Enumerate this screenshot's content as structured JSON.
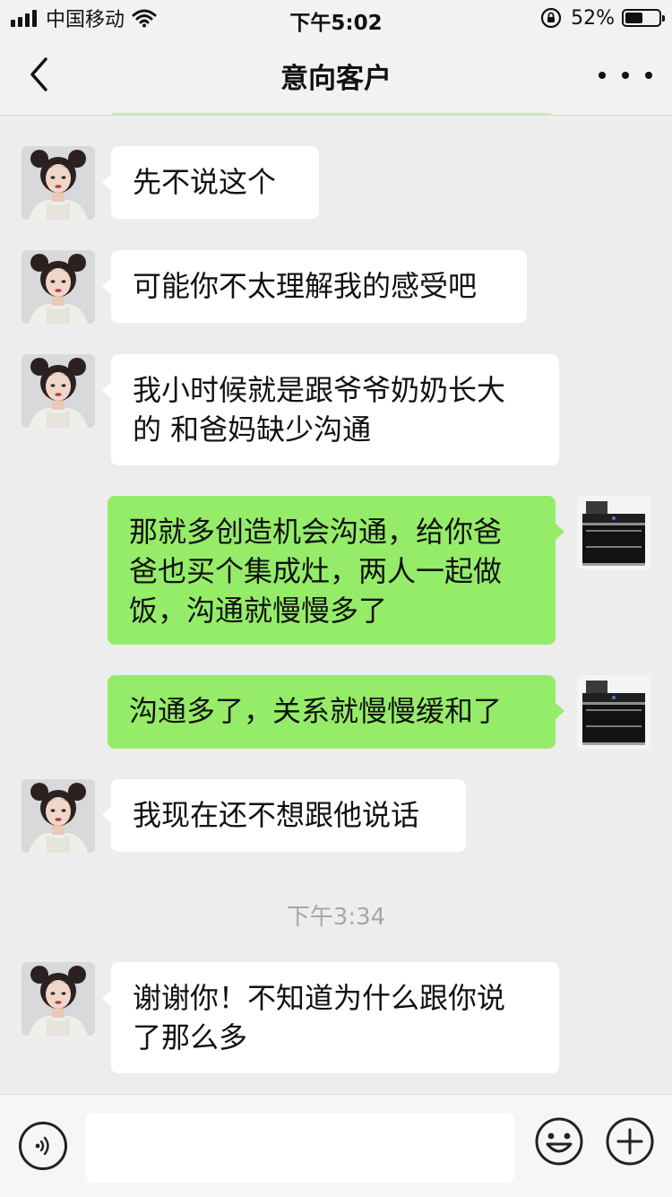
{
  "status_bar": {
    "carrier": "中国移动",
    "time": "下午5:02",
    "battery_percent": "52%",
    "battery_level": 0.52,
    "icons": [
      "signal-icon",
      "wifi-icon",
      "rotation-lock-icon",
      "battery-icon"
    ]
  },
  "nav": {
    "title": "意向客户",
    "back_icon": "chevron-left-icon",
    "more_icon": "ellipsis-icon"
  },
  "messages": [
    {
      "side": "in",
      "text": "先不说这个"
    },
    {
      "side": "in",
      "text": "可能你不太理解我的感受吧"
    },
    {
      "side": "in",
      "line1": "我小时候就是跟爷爷奶奶长大",
      "line2": "的 和爸妈缺少沟通"
    },
    {
      "side": "out",
      "line1": "那就多创造机会沟通，给你爸",
      "line2": "爸也买个集成灶，两人一起做",
      "line3": "饭，沟通就慢慢多了"
    },
    {
      "side": "out",
      "text": "沟通多了，关系就慢慢缓和了"
    },
    {
      "side": "in",
      "text": "我现在还不想跟他说话"
    },
    {
      "side": "in",
      "line1": "谢谢你！不知道为什么跟你说",
      "line2": "了那么多"
    }
  ],
  "timestamp": "下午3:34",
  "input_bar": {
    "value": "",
    "voice_icon": "voice-icon",
    "emoji_icon": "emoji-icon",
    "plus_icon": "plus-icon"
  },
  "colors": {
    "background": "#ededed",
    "bubble_in": "#ffffff",
    "bubble_out": "#95ec69",
    "timestamp": "#a7a7a7"
  }
}
